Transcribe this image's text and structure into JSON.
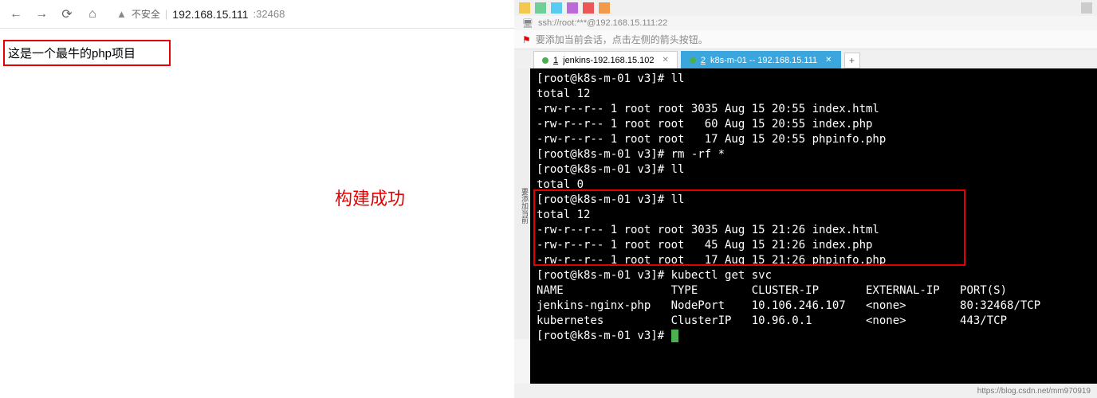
{
  "browser": {
    "secure_label": "不安全",
    "address_host": "192.168.15.111",
    "address_port": ":32468"
  },
  "page": {
    "heading": "这是一个最牛的php项目",
    "build_success_label": "构建成功"
  },
  "ssh": {
    "connection": "ssh://root:***@192.168.15.111:22",
    "hint_text": "要添加当前会话，点击左侧的箭头按钮。"
  },
  "tabs": [
    {
      "index": "1",
      "label": "jenkins-192.168.15.102",
      "active": false
    },
    {
      "index": "2",
      "label": "k8s-m-01 -- 192.168.15.111",
      "active": true
    }
  ],
  "side_gutter": "要添加当前",
  "terminal": {
    "prompt": "[root@k8s-m-01 v3]#",
    "cmd_ll": "ll",
    "cmd_rm": "rm -rf *",
    "cmd_kubectl": "kubectl get svc",
    "total12": "total 12",
    "total0": "total 0",
    "ls_before": [
      "-rw-r--r-- 1 root root 3035 Aug 15 20:55 index.html",
      "-rw-r--r-- 1 root root   60 Aug 15 20:55 index.php",
      "-rw-r--r-- 1 root root   17 Aug 15 20:55 phpinfo.php"
    ],
    "ls_after": [
      "-rw-r--r-- 1 root root 3035 Aug 15 21:26 index.html",
      "-rw-r--r-- 1 root root   45 Aug 15 21:26 index.php",
      "-rw-r--r-- 1 root root   17 Aug 15 21:26 phpinfo.php"
    ],
    "svc_header": "NAME                TYPE        CLUSTER-IP       EXTERNAL-IP   PORT(S)",
    "svc_rows": [
      "jenkins-nginx-php   NodePort    10.106.246.107   <none>        80:32468/TCP",
      "kubernetes          ClusterIP   10.96.0.1        <none>        443/TCP"
    ]
  },
  "status": {
    "url": "https://blog.csdn.net/mm970919"
  }
}
